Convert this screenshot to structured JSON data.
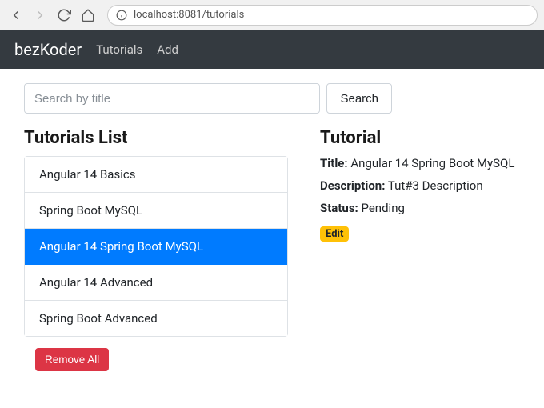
{
  "browser": {
    "url": "localhost:8081/tutorials"
  },
  "navbar": {
    "brand": "bezKoder",
    "links": [
      "Tutorials",
      "Add"
    ]
  },
  "search": {
    "placeholder": "Search by title",
    "button": "Search"
  },
  "list": {
    "heading": "Tutorials List",
    "items": [
      {
        "title": "Angular 14 Basics",
        "active": false
      },
      {
        "title": "Spring Boot MySQL",
        "active": false
      },
      {
        "title": "Angular 14 Spring Boot MySQL",
        "active": true
      },
      {
        "title": "Angular 14 Advanced",
        "active": false
      },
      {
        "title": "Spring Boot Advanced",
        "active": false
      }
    ],
    "remove_all": "Remove All"
  },
  "detail": {
    "heading": "Tutorial",
    "labels": {
      "title": "Title:",
      "description": "Description:",
      "status": "Status:"
    },
    "title": "Angular 14 Spring Boot MySQL",
    "description": "Tut#3 Description",
    "status": "Pending",
    "edit": "Edit"
  }
}
